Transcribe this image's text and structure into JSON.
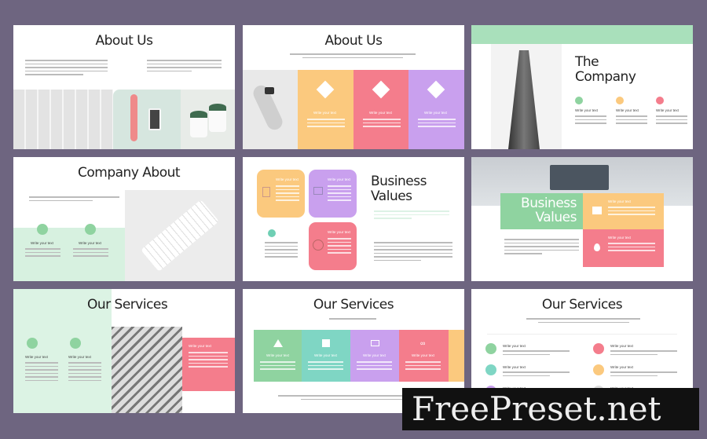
{
  "slides": [
    {
      "title": "About Us"
    },
    {
      "title": "About Us",
      "labels": [
        "Write your text",
        "Write your text",
        "Write your text"
      ]
    },
    {
      "title": "The Company",
      "labels": [
        "Write your text",
        "Write your text",
        "Write your text"
      ]
    },
    {
      "title": "Company About",
      "labels": [
        "Write your text",
        "Write your text"
      ]
    },
    {
      "title": "Business Values",
      "labels": [
        "Write your text",
        "Write your text",
        "Write your text"
      ]
    },
    {
      "title": "Business Values",
      "labels": [
        "Write your text",
        "Write your text"
      ]
    },
    {
      "title": "Our Services",
      "labels": [
        "Write your text",
        "Write your text",
        "Write your text"
      ]
    },
    {
      "title": "Our Services",
      "labels": [
        "Write your text",
        "Write your text",
        "Write your text",
        "Write your text"
      ]
    },
    {
      "title": "Our Services",
      "labels": [
        "Write your text",
        "Write your text",
        "Write your text",
        "Write your text",
        "Write your text",
        "Write your text"
      ]
    }
  ],
  "colors": {
    "background": "#6e6580",
    "mint": "#c9ecd6",
    "orange": "#fbc97e",
    "pink": "#f47d8c",
    "purple": "#c9a0ee",
    "green": "#8fd3a0",
    "teal": "#7fd6c4"
  },
  "watermark": "FreePreset.net"
}
